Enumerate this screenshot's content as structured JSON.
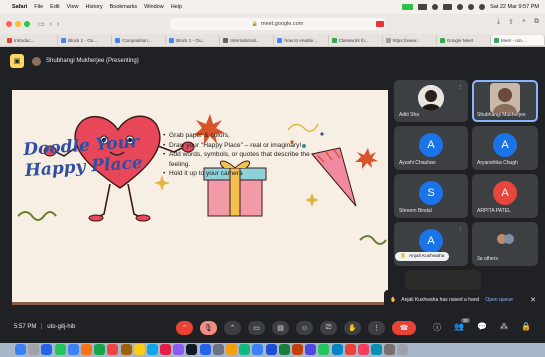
{
  "menubar": {
    "app": "Safari",
    "items": [
      "File",
      "Edit",
      "View",
      "History",
      "Bookmarks",
      "Window",
      "Help"
    ],
    "clock": "Sat 22 Mar  9:57 PM"
  },
  "browser": {
    "url": "meet.google.com",
    "tabs": [
      {
        "label": "Introduc...",
        "color": "#e94235"
      },
      {
        "label": "Block 1 - Ou...",
        "color": "#4285f4"
      },
      {
        "label": "Composition...",
        "color": "#4285f4"
      },
      {
        "label": "Block 1 - Ou...",
        "color": "#4285f4"
      },
      {
        "label": "International...",
        "color": "#5f6368"
      },
      {
        "label": "how to enable...",
        "color": "#4285f4"
      },
      {
        "label": "Classwork fo...",
        "color": "#34a853"
      },
      {
        "label": "https://www...",
        "color": "#9aa0a6"
      },
      {
        "label": "Google Meet",
        "color": "#34a853"
      },
      {
        "label": "Meet - uto-...",
        "color": "#34a853"
      }
    ]
  },
  "meet": {
    "presenter_label": "Shubhangi Mukherjee (Presenting)",
    "meeting_time": "5:57 PM",
    "meeting_code": "uto-gitj-hib",
    "notification": {
      "text": "Anjali Kushwaha has raised a hand",
      "action": "Open queue"
    },
    "participants": [
      {
        "name": "Aditi Sha",
        "initial": "",
        "color": "#3c4043",
        "photo": true
      },
      {
        "name": "Shubhangi Mukherjee",
        "initial": "",
        "color": "#3c4043",
        "photo": true
      },
      {
        "name": "Ayushi Chauhan",
        "initial": "A",
        "color": "#1a73e8"
      },
      {
        "name": "Aryanshika Chugh",
        "initial": "A",
        "color": "#1a73e8"
      },
      {
        "name": "Shreem Bindal",
        "initial": "S",
        "color": "#1a73e8"
      },
      {
        "name": "ARPITA PATEL",
        "initial": "A",
        "color": "#e8453c"
      },
      {
        "name": "Anjali Kushwaha",
        "initial": "A",
        "color": "#1a73e8"
      },
      {
        "name": "3a others",
        "initial": "",
        "color": "#3c4043"
      }
    ],
    "participant_count": "38"
  },
  "slide": {
    "title_line1": "Doodle Your",
    "title_line2": "Happy Place",
    "bullets": [
      "Grab paper & colors.",
      "Draw your \"Happy Place\" – real or imaginary!",
      "Add words, symbols, or quotes that describe the feeling.",
      "Hold it up to your camera"
    ]
  },
  "colors": {
    "meet_bg": "#202124",
    "slide_bg": "#f8efe4",
    "title_blue": "#2f4fa3",
    "end_call_red": "#ea4335"
  }
}
